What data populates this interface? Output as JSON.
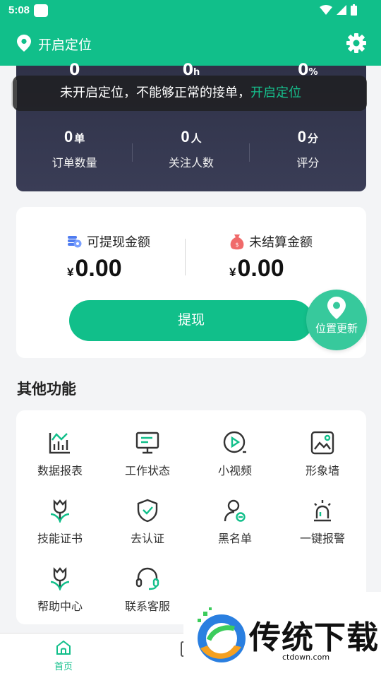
{
  "status_bar": {
    "time": "5:08"
  },
  "header": {
    "location_label": "开启定位"
  },
  "stats_top": [
    {
      "value": "0",
      "unit": ""
    },
    {
      "value": "0",
      "unit": "h"
    },
    {
      "value": "0",
      "unit": "%"
    }
  ],
  "toast": {
    "message": "未开启定位，不能够正常的接单，",
    "link": "开启定位"
  },
  "stats": [
    {
      "value": "0",
      "unit": "单",
      "label": "订单数量"
    },
    {
      "value": "0",
      "unit": "人",
      "label": "关注人数"
    },
    {
      "value": "0",
      "unit": "分",
      "label": "评分"
    }
  ],
  "balance": {
    "withdrawable_label": "可提现金额",
    "withdrawable_currency": "¥",
    "withdrawable_amount": "0.00",
    "unsettled_label": "未结算金额",
    "unsettled_currency": "¥",
    "unsettled_amount": "0.00",
    "withdraw_button": "提现"
  },
  "location_update": "位置更新",
  "section_title": "其他功能",
  "functions": [
    {
      "label": "数据报表",
      "icon": "chart-icon"
    },
    {
      "label": "工作状态",
      "icon": "monitor-icon"
    },
    {
      "label": "小视频",
      "icon": "play-icon"
    },
    {
      "label": "形象墙",
      "icon": "image-icon"
    },
    {
      "label": "技能证书",
      "icon": "tulip-icon"
    },
    {
      "label": "去认证",
      "icon": "shield-check-icon"
    },
    {
      "label": "黑名单",
      "icon": "user-block-icon"
    },
    {
      "label": "一键报警",
      "icon": "alarm-icon"
    },
    {
      "label": "帮助中心",
      "icon": "tulip-icon"
    },
    {
      "label": "联系客服",
      "icon": "headset-icon"
    }
  ],
  "bottom_nav": {
    "home_label": "首页"
  },
  "watermark": {
    "text": "传统下载",
    "url": "ctdown.com"
  },
  "colors": {
    "brand": "#11bf8a",
    "dark_card": "#2f3248"
  }
}
